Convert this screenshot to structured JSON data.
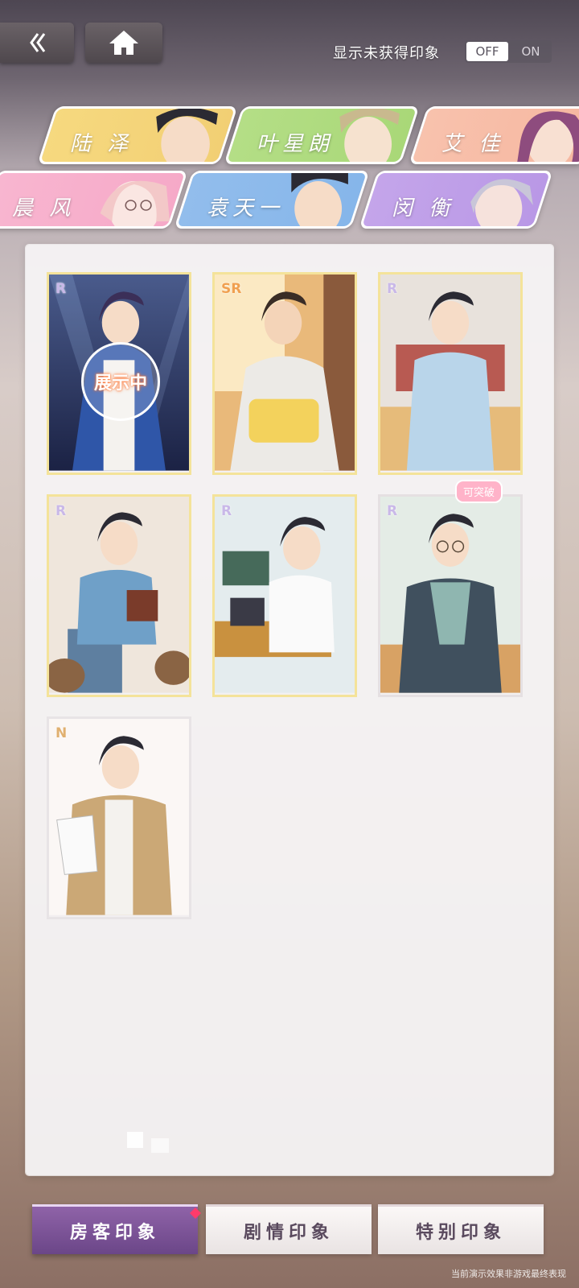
{
  "header": {
    "toggle_label": "显示未获得印象",
    "toggle_off": "OFF",
    "toggle_on": "ON"
  },
  "characters": [
    {
      "name": "陆 泽",
      "color": "#f2cf74"
    },
    {
      "name": "叶星朗",
      "color": "#a9d878"
    },
    {
      "name": "艾 佳",
      "color": "#f6b7a0"
    },
    {
      "name": "晨 风",
      "color": "#f6a9c8"
    },
    {
      "name": "袁天一",
      "color": "#86b6ea"
    },
    {
      "name": "闵 衡",
      "color": "#b998e6"
    }
  ],
  "cards": [
    {
      "rarity": "R",
      "overlay": "展示中"
    },
    {
      "rarity": "SR"
    },
    {
      "rarity": "R"
    },
    {
      "rarity": "R"
    },
    {
      "rarity": "R"
    },
    {
      "rarity": "R",
      "badge": "可突破"
    },
    {
      "rarity": "N"
    }
  ],
  "bottom_tabs": [
    {
      "label": "房客印象",
      "active": true
    },
    {
      "label": "剧情印象",
      "active": false
    },
    {
      "label": "特别印象",
      "active": false
    }
  ],
  "footnote": "当前演示效果非游戏最终表现"
}
